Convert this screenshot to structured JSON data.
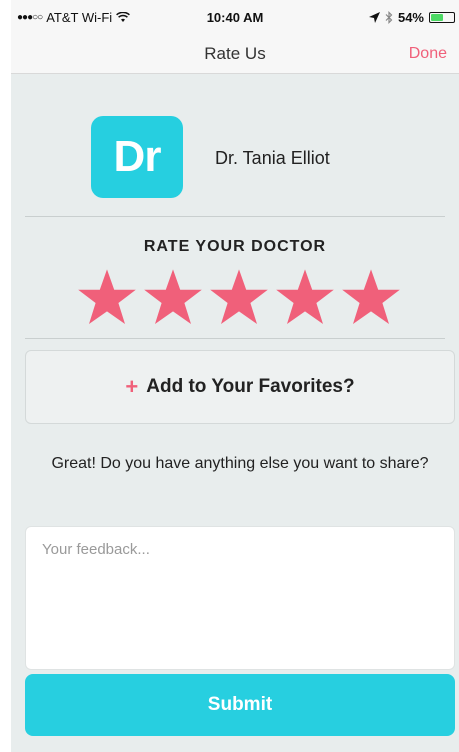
{
  "status_bar": {
    "signal": "●●●○○",
    "carrier": "AT&T Wi-Fi",
    "time": "10:40 AM",
    "battery_percent": "54%",
    "battery_level": 0.54
  },
  "nav": {
    "title": "Rate Us",
    "done_label": "Done"
  },
  "doctor": {
    "logo_text": "Dr",
    "name": "Dr. Tania Elliot"
  },
  "rating": {
    "title": "RATE YOUR DOCTOR",
    "value": 5,
    "max": 5
  },
  "favorites": {
    "plus": "+",
    "label": "Add to Your Favorites?"
  },
  "feedback": {
    "question": "Great! Do you have anything else you want to share?",
    "placeholder": "Your feedback...",
    "value": ""
  },
  "submit": {
    "label": "Submit"
  },
  "colors": {
    "accent_teal": "#27cfe0",
    "star_pink": "#f0607a",
    "background": "#e8eded"
  },
  "icons": [
    "wifi-icon",
    "location-arrow-icon",
    "bluetooth-icon",
    "battery-icon",
    "star-icon",
    "plus-icon"
  ]
}
